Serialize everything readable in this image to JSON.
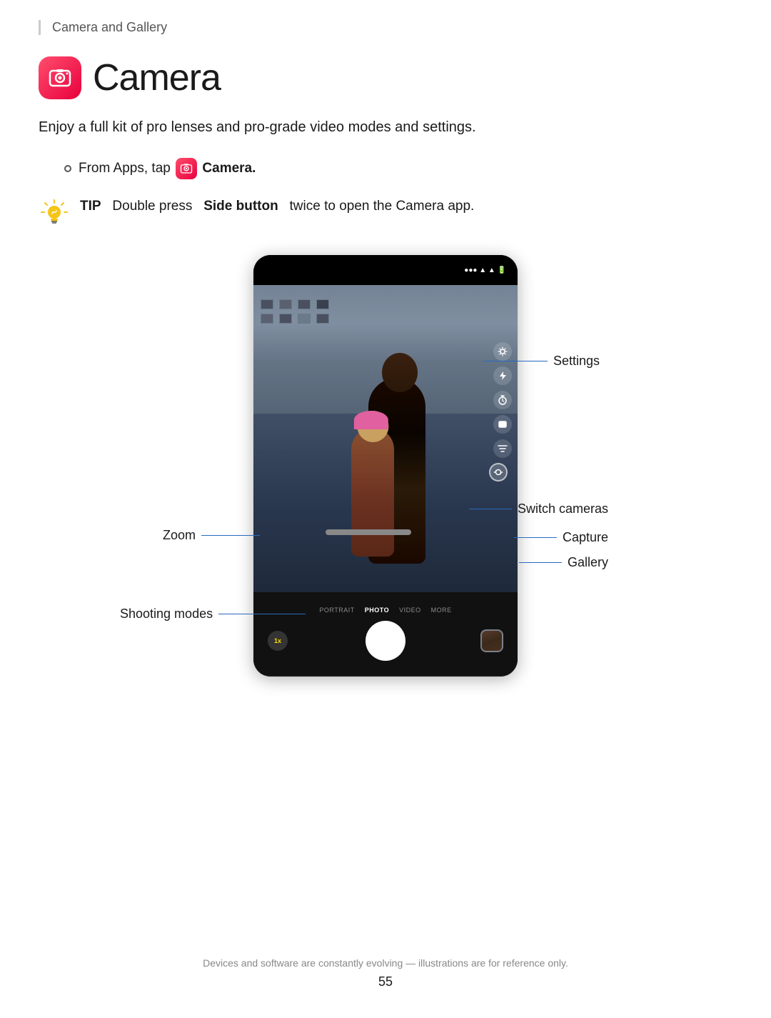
{
  "breadcrumb": {
    "text": "Camera and Gallery"
  },
  "header": {
    "title": "Camera",
    "description": "Enjoy a full kit of pro lenses and pro-grade video modes and settings."
  },
  "bullet": {
    "text_before": "From Apps, tap",
    "app_name": "Camera.",
    "bullet_symbol": "○"
  },
  "tip": {
    "label": "TIP",
    "text_before": "Double press",
    "bold_text": "Side button",
    "text_after": "twice to open the Camera app."
  },
  "diagram": {
    "annotations": {
      "settings": "Settings",
      "switch_cameras": "Switch cameras",
      "zoom": "Zoom",
      "capture": "Capture",
      "gallery": "Gallery",
      "shooting_modes": "Shooting modes"
    },
    "shooting_modes": [
      "PORTRAIT",
      "PHOTO",
      "VIDEO",
      "MORE"
    ],
    "active_mode": "PHOTO"
  },
  "footer": {
    "note": "Devices and software are constantly evolving — illustrations are for reference only.",
    "page": "55"
  }
}
